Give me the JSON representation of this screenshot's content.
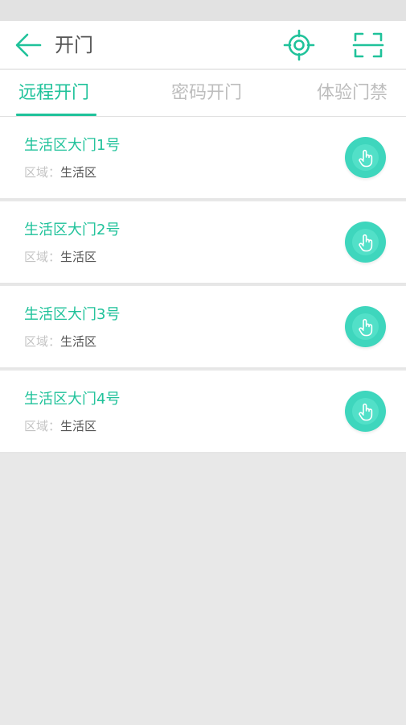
{
  "header": {
    "title": "开门",
    "back_icon": "arrow-left-icon",
    "locate_icon": "crosshair-target-icon",
    "scan_icon": "scan-frame-icon"
  },
  "tabs": [
    {
      "label": "远程开门",
      "active": true
    },
    {
      "label": "密码开门",
      "active": false
    },
    {
      "label": "体验门禁",
      "active": false
    }
  ],
  "doors": [
    {
      "name": "生活区大门1号",
      "area_label": "区域：",
      "area_value": "生活区",
      "button_icon": "tap-hand-icon"
    },
    {
      "name": "生活区大门2号",
      "area_label": "区域：",
      "area_value": "生活区",
      "button_icon": "tap-hand-icon"
    },
    {
      "name": "生活区大门3号",
      "area_label": "区域：",
      "area_value": "生活区",
      "button_icon": "tap-hand-icon"
    },
    {
      "name": "生活区大门4号",
      "area_label": "区域：",
      "area_value": "生活区",
      "button_icon": "tap-hand-icon"
    }
  ],
  "colors": {
    "accent": "#1fc29a",
    "button": "#3ed6bd",
    "tab_inactive": "#bdbdbd",
    "background": "#e8e8e8"
  }
}
